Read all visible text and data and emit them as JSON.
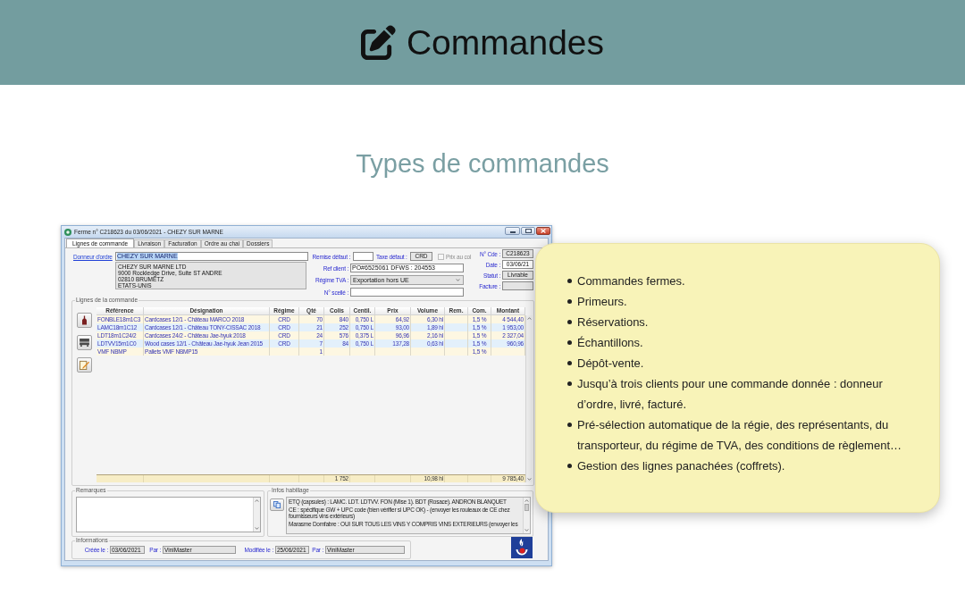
{
  "header": {
    "title": "Commandes"
  },
  "section": {
    "title": "Types de commandes"
  },
  "app_window": {
    "title": "Ferme n° C218623 du 03/06/2021 - CHEZY SUR MARNE",
    "tabs": [
      {
        "label": "Lignes de commande",
        "selected": true
      },
      {
        "label": "Livraison",
        "selected": false
      },
      {
        "label": "Facturation",
        "selected": false
      },
      {
        "label": "Ordre au chai",
        "selected": false
      },
      {
        "label": "Dossiers",
        "selected": false
      }
    ],
    "client": {
      "link": "Donneur d'ordre",
      "value": "CHEZY SUR MARNE",
      "value_selected": true,
      "address": [
        "CHEZY SUR MARNE LTD",
        "9000 Rockledge Drive, Suite ST ANDRE",
        "02810 BRUMETZ",
        "ETATS-UNIS"
      ]
    },
    "remise_defaut": {
      "label": "Remise défaut :"
    },
    "taxe_defaut": {
      "label": "Taxe défaut :",
      "value": "CRD"
    },
    "prix_au_col": {
      "label": "Prix au col",
      "checked": false,
      "disabled": true
    },
    "ref_client": {
      "label": "Ref client :",
      "value": "PO#6525061 DFWS : 204553"
    },
    "regime_tva": {
      "label": "Régime TVA :",
      "value": "Exportation hors UE"
    },
    "scelle": {
      "label": "N° scellé :"
    },
    "order_fields": [
      {
        "label": "N° Cde :",
        "value": "C218623"
      },
      {
        "label": "Date :",
        "value": "03/06/21"
      },
      {
        "label": "Statut :",
        "value": "Livrable"
      },
      {
        "label": "Facture :"
      }
    ],
    "lines": {
      "title": "Lignes de la commande",
      "columns": [
        "Référence",
        "Désignation",
        "Régime",
        "Qté",
        "Colis",
        "Centil.",
        "Prix",
        "Volume",
        "Rem.",
        "Com.",
        "Montant"
      ],
      "rows": [
        {
          "reference": "FONBLE18m1C3",
          "designation": "Cardcases 12/1 - Château MARCO 2018",
          "regime": "CRD",
          "qte": "70",
          "colis": "840",
          "centil": "0,750 L",
          "prix": "64,92",
          "volume": "6,30 hl",
          "com": "1,5 %",
          "montant": "4 544,40"
        },
        {
          "reference": "LAMC18m1C12",
          "designation": "Cardcases 12/1 - Château TONY-CISSAC 2018",
          "regime": "CRD",
          "qte": "21",
          "colis": "252",
          "centil": "0,750 L",
          "prix": "93,00",
          "volume": "1,89 hl",
          "com": "1,5 %",
          "montant": "1 953,00"
        },
        {
          "reference": "LDT18m1C24/2",
          "designation": "Cardcases 24/2 - Château Jae-hyuk 2018",
          "regime": "CRD",
          "qte": "24",
          "colis": "576",
          "centil": "0,375 L",
          "prix": "96,96",
          "volume": "2,16 hl",
          "com": "1,5 %",
          "montant": "2 327,04"
        },
        {
          "reference": "LDTVV15m1C0",
          "designation": "Wood cases 12/1 - Château Jae-hyuk Jean 2015",
          "regime": "CRD",
          "qte": "7",
          "colis": "84",
          "centil": "0,750 L",
          "prix": "137,28",
          "volume": "0,63 hl",
          "com": "1,5 %",
          "montant": "960,96"
        },
        {
          "reference": "VMF NBMP",
          "designation": "Pallets VMF NBMP15",
          "qte": "1",
          "com": "1,5 %"
        }
      ],
      "totals": {
        "colis": "1 752",
        "volume": "10,98 hl",
        "montant": "9 785,40"
      }
    },
    "remarques": {
      "title": "Remarques"
    },
    "infos_habillage": {
      "title": "Infos habillage",
      "paragraphs": [
        "ETQ (capsules) : LAMC. LDT. LDTVV. FON (Mise 1). BDT (Rosace). ANDRON BLANQUET",
        "CE : spécifique GW + UPC code (bien vérifier si UPC OK) - (envoyer les rouleaux de CE chez fournisseurs vins extérieurs)",
        "Marasme Domfabre : OUI SUR TOUS LES VINS Y COMPRIS VINS EXTERIEURS (envoyer les"
      ]
    },
    "informations": {
      "title": "Informations",
      "fields": [
        {
          "label": "Créée le :",
          "value": "03/06/2021"
        },
        {
          "label": "Par :",
          "value": "ViniMaster"
        },
        {
          "label": "Modifiée le :",
          "value": "25/06/2021"
        },
        {
          "label": "Par :",
          "value": "ViniMaster"
        }
      ]
    }
  },
  "features": {
    "items": [
      "Commandes fermes.",
      "Primeurs.",
      "Réservations.",
      "Échantillons.",
      "Dépôt-vente.",
      "Jusqu’à trois clients pour une commande donnée : donneur d’ordre, livré, facturé.",
      "Pré-sélection automatique de la régie, des représentants, du transporteur, du régime de TVA, des conditions de règlement…",
      "Gestion des lignes panachées (coffrets)."
    ]
  }
}
